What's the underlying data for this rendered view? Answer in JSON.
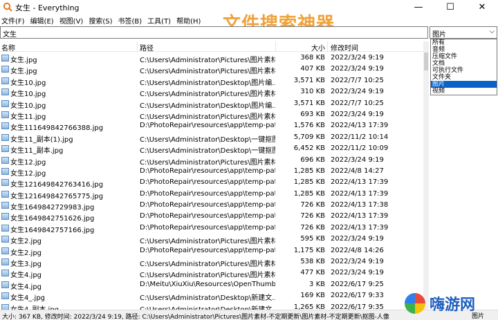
{
  "window": {
    "title": "女生 - Everything",
    "minimize_glyph": "—",
    "maximize_glyph": "☐",
    "close_glyph": "✕"
  },
  "menu": [
    "文件(F)",
    "编辑(E)",
    "视图(V)",
    "搜索(S)",
    "书签(B)",
    "工具(T)",
    "帮助(H)"
  ],
  "watermark": "文件搜索神器",
  "search": {
    "value": "文生"
  },
  "filter": {
    "selected": "图片",
    "arrow": "⌵",
    "options": [
      "所有",
      "音频",
      "压缩文件",
      "文档",
      "可执行文件",
      "文件夹",
      "图片",
      "视频"
    ],
    "highlighted_index": 6
  },
  "columns": {
    "name": "名称",
    "path": "路径",
    "size": "大小",
    "modified": "修改时间"
  },
  "rows": [
    {
      "name": "女生.jpg",
      "path": "C:\\Users\\Administrator\\Pictures\\图片素材...",
      "size": "368 KB",
      "date": "2022/3/24 9:19"
    },
    {
      "name": "女生.jpg",
      "path": "C:\\Users\\Administrator\\Pictures\\图片素材...",
      "size": "407 KB",
      "date": "2022/3/24 9:19"
    },
    {
      "name": "女生10.jpg",
      "path": "C:\\Users\\Administrator\\Desktop\\图片编...",
      "size": "3,571 KB",
      "date": "2022/7/7 10:25"
    },
    {
      "name": "女生10.jpg",
      "path": "C:\\Users\\Administrator\\Pictures\\图片素材...",
      "size": "310 KB",
      "date": "2022/3/24 9:19"
    },
    {
      "name": "女生10.jpg",
      "path": "C:\\Users\\Administrator\\Desktop\\图片编...",
      "size": "3,571 KB",
      "date": "2022/7/7 10:25"
    },
    {
      "name": "女生11.jpg",
      "path": "C:\\Users\\Administrator\\Pictures\\图片素材...",
      "size": "693 KB",
      "date": "2022/3/24 9:19"
    },
    {
      "name": "女生111649842766388.jpg",
      "path": "D:\\PhotoRepair\\resources\\app\\temp-pat...",
      "size": "1,576 KB",
      "date": "2022/4/13 17:39"
    },
    {
      "name": "女生11_副本(1).jpg",
      "path": "C:\\Users\\Administrator\\Desktop\\一键抠图",
      "size": "5,709 KB",
      "date": "2022/11/2 10:14"
    },
    {
      "name": "女生11_副本.jpg",
      "path": "C:\\Users\\Administrator\\Desktop\\一键抠图",
      "size": "6,452 KB",
      "date": "2022/11/2 10:09"
    },
    {
      "name": "女生12.jpg",
      "path": "C:\\Users\\Administrator\\Pictures\\图片素材...",
      "size": "696 KB",
      "date": "2022/3/24 9:19"
    },
    {
      "name": "女生12.jpg",
      "path": "D:\\PhotoRepair\\resources\\app\\temp-pat...",
      "size": "1,285 KB",
      "date": "2022/4/8 14:27"
    },
    {
      "name": "女生121649842763416.jpg",
      "path": "D:\\PhotoRepair\\resources\\app\\temp-pat...",
      "size": "1,285 KB",
      "date": "2022/4/13 17:39"
    },
    {
      "name": "女生121649842765775.jpg",
      "path": "D:\\PhotoRepair\\resources\\app\\temp-pat...",
      "size": "1,285 KB",
      "date": "2022/4/13 17:39"
    },
    {
      "name": "女生1649842729983.jpg",
      "path": "D:\\PhotoRepair\\resources\\app\\temp-pat...",
      "size": "726 KB",
      "date": "2022/4/13 17:38"
    },
    {
      "name": "女生1649842751626.jpg",
      "path": "D:\\PhotoRepair\\resources\\app\\temp-pat...",
      "size": "726 KB",
      "date": "2022/4/13 17:39"
    },
    {
      "name": "女生1649842757166.jpg",
      "path": "D:\\PhotoRepair\\resources\\app\\temp-pat...",
      "size": "726 KB",
      "date": "2022/4/13 17:39"
    },
    {
      "name": "女生2.jpg",
      "path": "C:\\Users\\Administrator\\Pictures\\图片素材...",
      "size": "595 KB",
      "date": "2022/3/24 9:19"
    },
    {
      "name": "女生2.jpg",
      "path": "D:\\PhotoRepair\\resources\\app\\temp-pat...",
      "size": "1,175 KB",
      "date": "2022/4/8 14:26"
    },
    {
      "name": "女生3.jpg",
      "path": "C:\\Users\\Administrator\\Pictures\\图片素材...",
      "size": "538 KB",
      "date": "2022/3/24 9:19"
    },
    {
      "name": "女生4.jpg",
      "path": "C:\\Users\\Administrator\\Pictures\\图片素材...",
      "size": "477 KB",
      "date": "2022/3/24 9:19"
    },
    {
      "name": "女生4.jpg",
      "path": "D:\\Meitu\\XiuXiu\\Resources\\OpenThumb",
      "size": "3 KB",
      "date": "2022/6/17 9:25"
    },
    {
      "name": "女生4_.jpg",
      "path": "C:\\Users\\Administrator\\Desktop\\新建文...",
      "size": "169 KB",
      "date": "2022/6/17 9:33"
    },
    {
      "name": "女生4_副本.jpg",
      "path": "C:\\Users\\Administrator\\Desktop\\新建文...",
      "size": "1,265 KB",
      "date": "2022/6/17 9:35"
    }
  ],
  "status": {
    "text": "大小: 367 KB, 修改时间: 2022/3/24 9:19, 路径: C:\\Users\\Administrator\\Pictures\\图片素材-不定期更新\\图片素材-不定期更新\\抠图-人像",
    "right": "图片"
  },
  "logo_text": "嗨游网"
}
